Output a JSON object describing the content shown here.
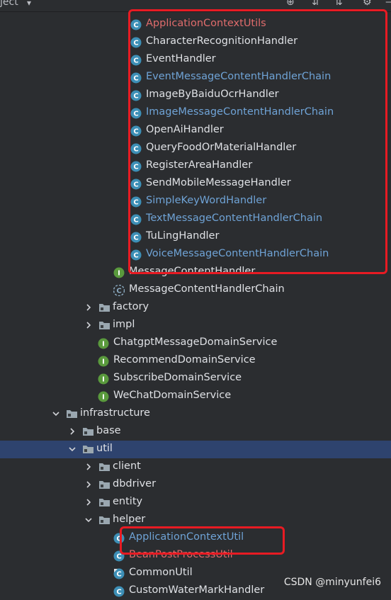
{
  "topbar": {
    "title": "ject",
    "tools": [
      "target-icon",
      "expand-all-icon",
      "collapse-all-icon",
      "gear-icon"
    ]
  },
  "tree": {
    "rows": [
      {
        "label": "ApplicationContextUtils",
        "type": "class",
        "color": "red",
        "indent": 5
      },
      {
        "label": "CharacterRecognitionHandler",
        "type": "class",
        "color": "white",
        "indent": 5
      },
      {
        "label": "EventHandler",
        "type": "class",
        "color": "white",
        "indent": 5
      },
      {
        "label": "EventMessageContentHandlerChain",
        "type": "class",
        "color": "blue",
        "indent": 5
      },
      {
        "label": "ImageByBaiduOcrHandler",
        "type": "class",
        "color": "white",
        "indent": 5
      },
      {
        "label": "ImageMessageContentHandlerChain",
        "type": "class",
        "color": "blue",
        "indent": 5
      },
      {
        "label": "OpenAiHandler",
        "type": "class",
        "color": "white",
        "indent": 5
      },
      {
        "label": "QueryFoodOrMaterialHandler",
        "type": "class",
        "color": "white",
        "indent": 5
      },
      {
        "label": "RegisterAreaHandler",
        "type": "class",
        "color": "white",
        "indent": 5
      },
      {
        "label": "SendMobileMessageHandler",
        "type": "class",
        "color": "white",
        "indent": 5
      },
      {
        "label": "SimpleKeyWordHandler",
        "type": "class",
        "color": "blue",
        "indent": 5
      },
      {
        "label": "TextMessageContentHandlerChain",
        "type": "class",
        "color": "blue",
        "indent": 5
      },
      {
        "label": "TuLingHandler",
        "type": "class",
        "color": "white",
        "indent": 5
      },
      {
        "label": "VoiceMessageContentHandlerChain",
        "type": "class",
        "color": "blue",
        "indent": 5
      },
      {
        "label": "MessageContentHandler",
        "type": "interface",
        "color": "white",
        "indent": 4
      },
      {
        "label": "MessageContentHandlerChain",
        "type": "abstract",
        "color": "white",
        "indent": 4
      },
      {
        "label": "factory",
        "type": "folder",
        "color": "white",
        "indent": 3,
        "arrow": "right"
      },
      {
        "label": "impl",
        "type": "folder",
        "color": "white",
        "indent": 3,
        "arrow": "right"
      },
      {
        "label": "ChatgptMessageDomainService",
        "type": "interface",
        "color": "white",
        "indent": 3
      },
      {
        "label": "RecommendDomainService",
        "type": "interface",
        "color": "white",
        "indent": 3
      },
      {
        "label": "SubscribeDomainService",
        "type": "interface",
        "color": "white",
        "indent": 3
      },
      {
        "label": "WeChatDomainService",
        "type": "interface",
        "color": "white",
        "indent": 3
      },
      {
        "label": "infrastructure",
        "type": "folder",
        "color": "white",
        "indent": 1,
        "arrow": "down"
      },
      {
        "label": "base",
        "type": "folder",
        "color": "white",
        "indent": 2,
        "arrow": "right"
      },
      {
        "label": "util",
        "type": "folder",
        "color": "white",
        "indent": 2,
        "arrow": "down",
        "selected": true
      },
      {
        "label": "client",
        "type": "folder",
        "color": "white",
        "indent": 3,
        "arrow": "right"
      },
      {
        "label": "dbdriver",
        "type": "folder",
        "color": "white",
        "indent": 3,
        "arrow": "right"
      },
      {
        "label": "entity",
        "type": "folder",
        "color": "white",
        "indent": 3,
        "arrow": "right"
      },
      {
        "label": "helper",
        "type": "folder",
        "color": "white",
        "indent": 3,
        "arrow": "down"
      },
      {
        "label": "ApplicationContextUtil",
        "type": "class",
        "color": "blue",
        "indent": 4
      },
      {
        "label": "BeanPostProcessUtil",
        "type": "class",
        "color": "red",
        "indent": 4
      },
      {
        "label": "CommonUtil",
        "type": "class-static",
        "color": "white",
        "indent": 4
      },
      {
        "label": "CustomWaterMarkHandler",
        "type": "class",
        "color": "white",
        "indent": 4
      }
    ]
  },
  "watermark": "CSDN @minyunfei6",
  "colors": {
    "red": "#e06c6c",
    "blue": "#6fa3d6",
    "white": "#dfe1e5",
    "highlight": "#e81b23",
    "selection": "#2e436e"
  }
}
